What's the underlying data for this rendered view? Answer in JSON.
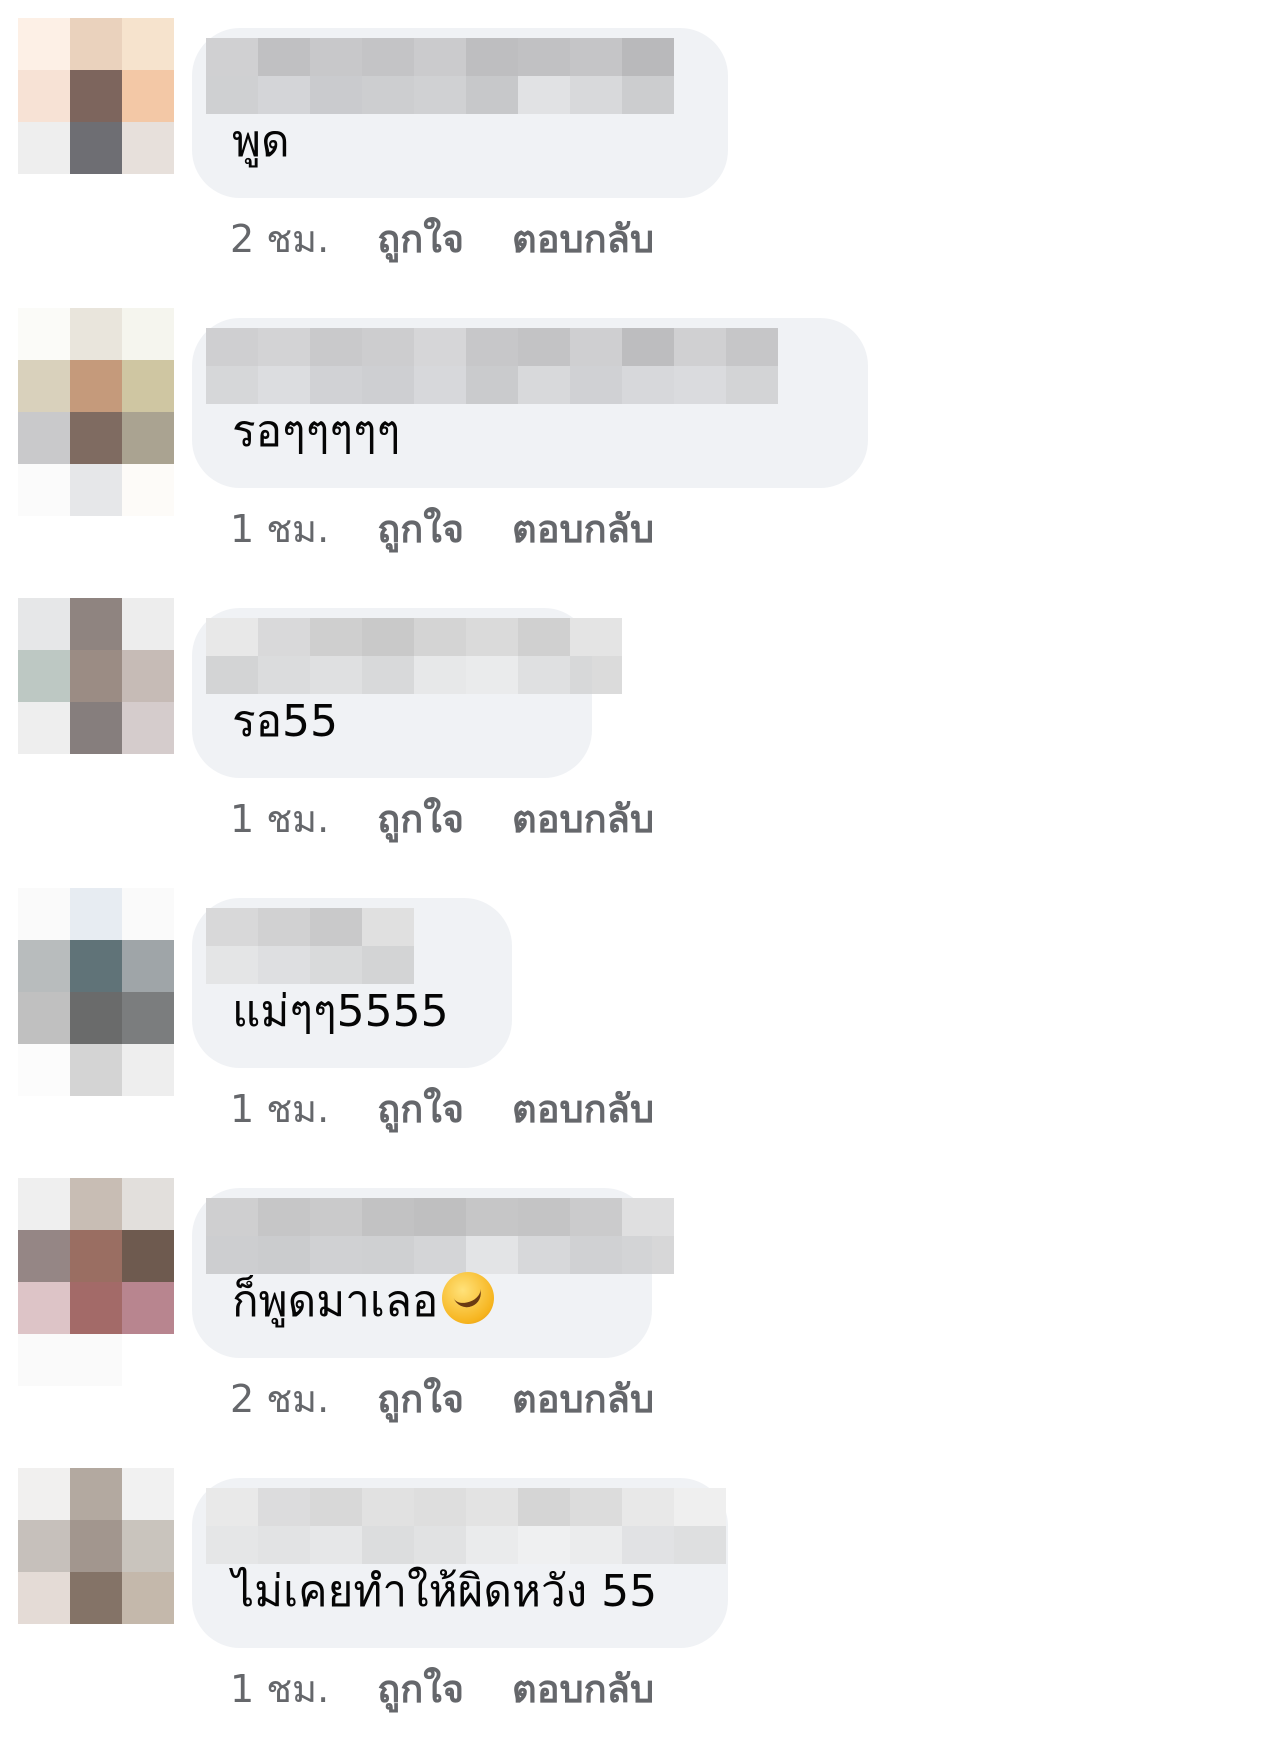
{
  "colors": {
    "bubble_bg": "#f0f2f5",
    "text": "#050505",
    "meta_text": "#65676b"
  },
  "comments": [
    {
      "text": "พูด",
      "time": "2 ชม.",
      "like_label": "ถูกใจ",
      "reply_label": "ตอบกลับ",
      "emoji_icon": ""
    },
    {
      "text": "รอๆๆๆๆๆ",
      "time": "1 ชม.",
      "like_label": "ถูกใจ",
      "reply_label": "ตอบกลับ",
      "emoji_icon": ""
    },
    {
      "text": "รอ55",
      "time": "1 ชม.",
      "like_label": "ถูกใจ",
      "reply_label": "ตอบกลับ",
      "emoji_icon": ""
    },
    {
      "text": "แม่ๆๆ5555",
      "time": "1 ชม.",
      "like_label": "ถูกใจ",
      "reply_label": "ตอบกลับ",
      "emoji_icon": ""
    },
    {
      "text": "ก็พูดมาเลอ",
      "time": "2 ชม.",
      "like_label": "ถูกใจ",
      "reply_label": "ตอบกลับ",
      "emoji_icon": "rolling-on-floor-laughing-emoji"
    },
    {
      "text": "ไม่เคยทำให้ผิดหวัง 55",
      "time": "1 ชม.",
      "like_label": "ถูกใจ",
      "reply_label": "ตอบกลับ",
      "emoji_icon": ""
    }
  ]
}
